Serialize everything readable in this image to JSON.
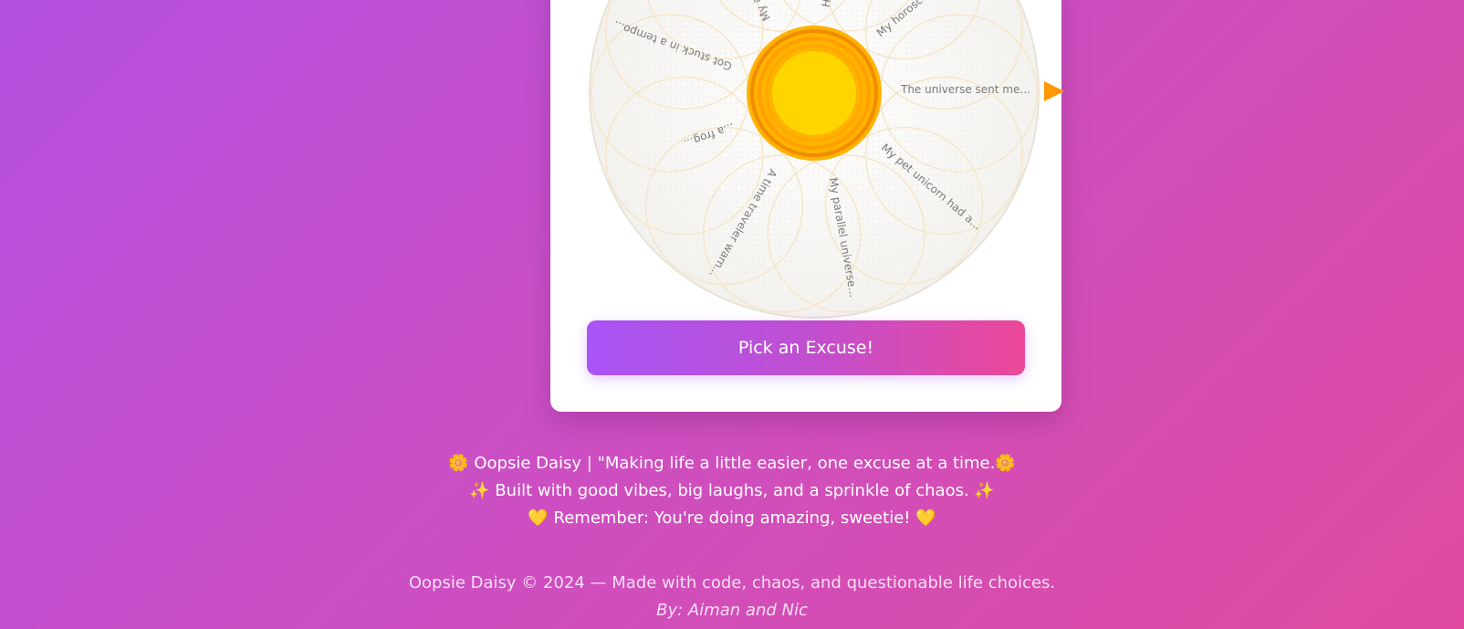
{
  "wheel": {
    "excuses": [
      "Got stuck in a tempo...",
      "My aura needed emerg...",
      "Had to attend an eme...",
      "My horoscope said to...",
      "The universe sent me...",
      "My pet unicorn had a...",
      "My parallel universe...",
      "A time traveler warn...",
      "...a frog..."
    ],
    "pointer_icon": "triangle-pointer-icon",
    "center_icon": "sun-flower-center-icon",
    "colors": {
      "center": "#ffd500",
      "ring": "#f59e0b",
      "pointer": "#ff9800",
      "petal_border": "#f5e6c8"
    }
  },
  "button": {
    "label": "Pick an Excuse!"
  },
  "footer": {
    "line1": "🌼 Oopsie Daisy | \"Making life a little easier, one excuse at a time.🌼",
    "line2": "✨ Built with good vibes, big laughs, and a sprinkle of chaos. ✨",
    "line3": "💛 Remember: You're doing amazing, sweetie! 💛"
  },
  "copyright": {
    "text": "Oopsie Daisy © 2024 — Made with code, chaos, and questionable life choices.",
    "by": "By: Aiman and Nic"
  }
}
